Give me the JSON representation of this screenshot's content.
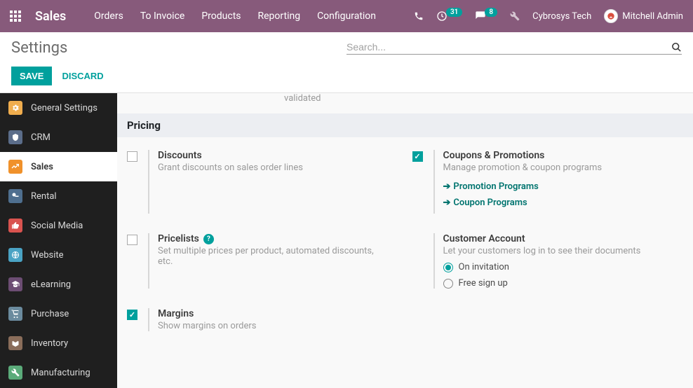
{
  "navbar": {
    "brand": "Sales",
    "links": [
      "Orders",
      "To Invoice",
      "Products",
      "Reporting",
      "Configuration"
    ],
    "activities_count": "31",
    "messages_count": "8",
    "company": "Cybrosys Tech",
    "user": "Mitchell Admin"
  },
  "control_panel": {
    "title": "Settings",
    "search_placeholder": "Search...",
    "save": "SAVE",
    "discard": "DISCARD"
  },
  "sidebar": {
    "items": [
      {
        "label": "General Settings",
        "icon": "gear",
        "bg": "#f0ad4e"
      },
      {
        "label": "CRM",
        "icon": "crm",
        "bg": "#5b6d8a"
      },
      {
        "label": "Sales",
        "icon": "sales",
        "bg": "#f0912b",
        "active": true
      },
      {
        "label": "Rental",
        "icon": "rental",
        "bg": "#4f6f8f"
      },
      {
        "label": "Social Media",
        "icon": "thumb",
        "bg": "#d9534f"
      },
      {
        "label": "Website",
        "icon": "globe",
        "bg": "#4aa3c4"
      },
      {
        "label": "eLearning",
        "icon": "elearn",
        "bg": "#6c4d73"
      },
      {
        "label": "Purchase",
        "icon": "purchase",
        "bg": "#6b8b9e"
      },
      {
        "label": "Inventory",
        "icon": "inventory",
        "bg": "#8a6d5a"
      },
      {
        "label": "Manufacturing",
        "icon": "wrench",
        "bg": "#5bab7a"
      }
    ]
  },
  "content": {
    "leftover_line": "validated",
    "section_title": "Pricing",
    "settings": {
      "discounts": {
        "title": "Discounts",
        "desc": "Grant discounts on sales order lines"
      },
      "coupons": {
        "title": "Coupons & Promotions",
        "desc": "Manage promotion & coupon programs",
        "link1": "Promotion Programs",
        "link2": "Coupon Programs"
      },
      "pricelists": {
        "title": "Pricelists",
        "desc": "Set multiple prices per product, automated discounts, etc."
      },
      "customer_account": {
        "title": "Customer Account",
        "desc": "Let your customers log in to see their documents",
        "opt1": "On invitation",
        "opt2": "Free sign up"
      },
      "margins": {
        "title": "Margins",
        "desc": "Show margins on orders"
      }
    }
  }
}
